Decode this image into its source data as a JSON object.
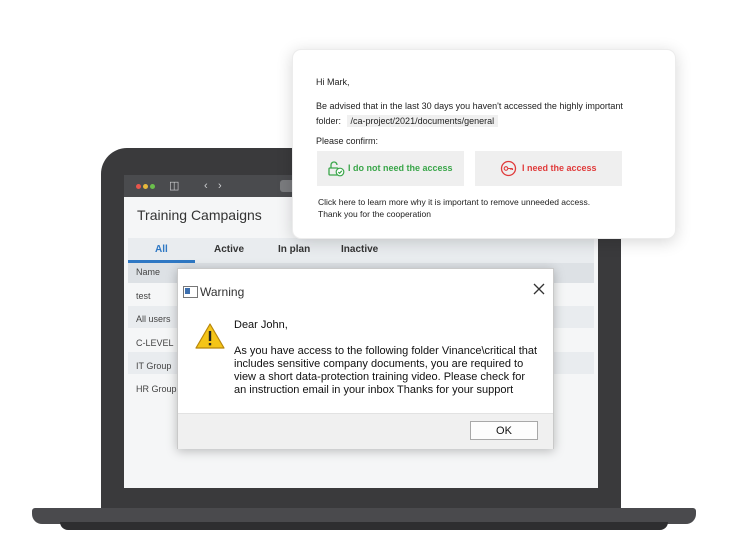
{
  "app": {
    "page_title": "Training Campaigns",
    "tabs": [
      "All",
      "Active",
      "In plan",
      "Inactive"
    ],
    "table_header": "Name",
    "rows": [
      "test",
      "All users",
      "C-LEVEL",
      "IT Group",
      "HR Group"
    ]
  },
  "dialog": {
    "title": "Warning",
    "greeting": "Dear John,",
    "message": "As you have access to the following folder Vinance\\critical that includes sensitive company documents, you are required to view a short data-protection training video. Please check for an instruction email in your inbox Thanks for your support",
    "ok_label": "OK"
  },
  "notification": {
    "greeting": "Hi Mark,",
    "advice": "Be advised that in the last 30 days you haven't accessed the highly important",
    "folder_prefix": "folder:",
    "folder_path": "/ca-project/2021/documents/general",
    "confirm_prompt": "Please confirm:",
    "no_access_label": "I do not need the access",
    "need_access_label": "I need the access",
    "learn_more": "Click here to learn more why it is important to remove unneeded access.",
    "thanks": "Thank you for the cooperation",
    "colors": {
      "confirm_green": "#3aa64a",
      "need_red": "#e03b3b"
    }
  }
}
